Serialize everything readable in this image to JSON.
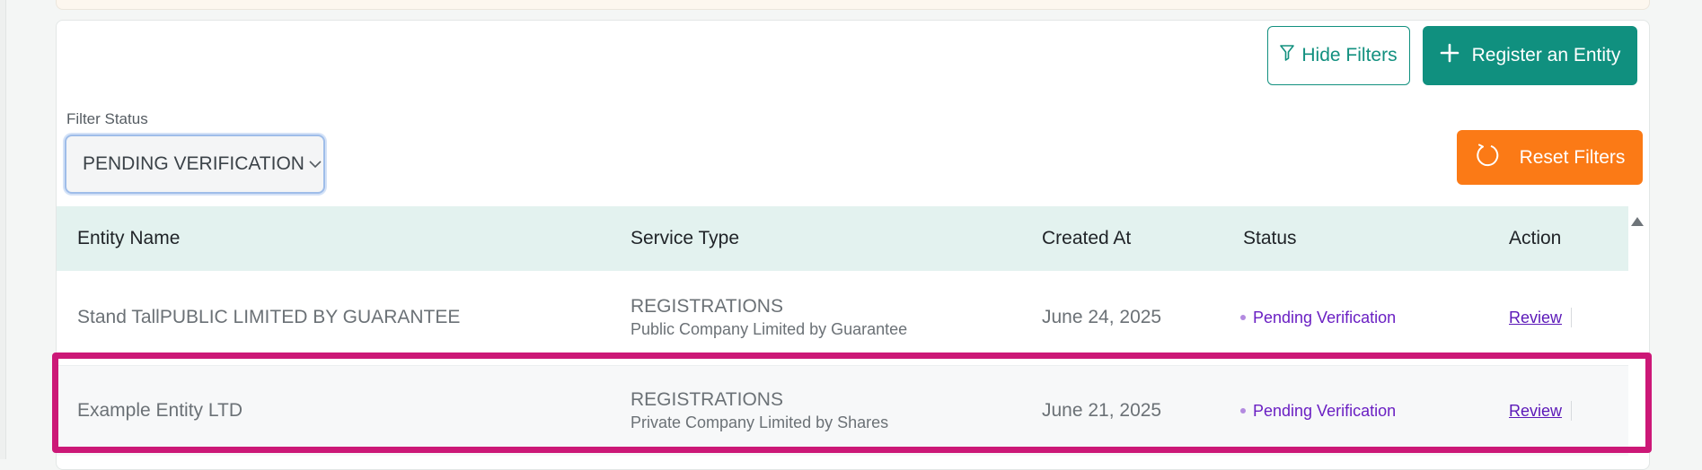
{
  "toolbar": {
    "hide_filters_label": "Hide Filters",
    "register_label": "Register an Entity",
    "reset_filters_label": "Reset Filters"
  },
  "filter": {
    "label": "Filter Status",
    "selected": "PENDING VERIFICATION"
  },
  "table": {
    "columns": [
      "Entity Name",
      "Service Type",
      "Created At",
      "Status",
      "Action"
    ],
    "rows": [
      {
        "entity_name": "Stand TallPUBLIC LIMITED BY GUARANTEE",
        "service_type": "REGISTRATIONS",
        "service_subtype": "Public Company Limited by Guarantee",
        "created_at": "June 24, 2025",
        "status": "Pending Verification",
        "action": "Review"
      },
      {
        "entity_name": "Example Entity LTD",
        "service_type": "REGISTRATIONS",
        "service_subtype": "Private Company Limited by Shares",
        "created_at": "June 21, 2025",
        "status": "Pending Verification",
        "action": "Review"
      }
    ]
  },
  "icons": {
    "hide_filters": "filter-icon",
    "register": "plus-icon",
    "reset": "refresh-icon",
    "select": "chevron-down-icon"
  },
  "colors": {
    "primary": "#10907f",
    "reset": "#fb7a16",
    "status": "#6a1fc3",
    "highlight": "#cc1877",
    "header_bg": "#e3f2ef"
  }
}
